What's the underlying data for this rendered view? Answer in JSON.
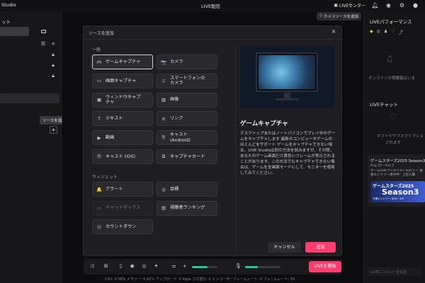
{
  "topbar": {
    "app_name": "Studio",
    "window_title": "LIVE配信",
    "live_center": "LIVEセンター"
  },
  "left_panel": {
    "title": "ット",
    "tooltip": "ソースを追加",
    "plus": "+"
  },
  "center": {
    "source_add_chip": "カメラソースを追加"
  },
  "right_panel": {
    "performance_title": "LIVEパフォーマンス",
    "offline_text": "オンラインの視聴者はいま",
    "chat_title": "LIVEチャット",
    "chat_empty_1": "ギフトやサブスクリプショ",
    "chat_empty_2": "されます",
    "card": {
      "title": "ゲームスターズ2025 Season3",
      "date": "Aug 29 - Sep 6",
      "text": "ゲームLIVEクリエイター向けトー 賞金エントリー受付中！上位入賞",
      "banner_line1": "ゲームスターズ2025",
      "banner_line2": "Season3",
      "banner_line3": "予選エントリー: 8/29 - 9/6"
    },
    "chat_input_placeholder": "LIVEにコメントを追加"
  },
  "modal": {
    "title": "ソースを追加",
    "close_glyph": "×",
    "section_general": "一般",
    "section_widget": "ウィジェット",
    "general_sources": [
      {
        "label": "ゲームキャプチャ",
        "icon": "🎮",
        "icon_name": "gamepad-icon",
        "selected": true
      },
      {
        "label": "カメラ",
        "icon": "📷",
        "icon_name": "camera-icon"
      },
      {
        "label": "画面キャプチャ",
        "icon": "▭",
        "icon_name": "screen-icon"
      },
      {
        "label": "スマートフォンの\nカメラ",
        "icon": "▯",
        "icon_name": "smartphone-icon"
      },
      {
        "label": "ウィンドウキャプ\nチャ",
        "icon": "▣",
        "icon_name": "window-icon"
      },
      {
        "label": "画像",
        "icon": "▨",
        "icon_name": "image-icon"
      },
      {
        "label": "テキスト",
        "icon": "T",
        "icon_name": "text-icon"
      },
      {
        "label": "リンク",
        "icon": "⊘",
        "icon_name": "link-icon"
      },
      {
        "label": "動画",
        "icon": "▶",
        "icon_name": "video-icon"
      },
      {
        "label": "キャスト\n(Android)",
        "icon": "⎘",
        "icon_name": "cast-android-icon"
      },
      {
        "label": "キャスト (iOS)",
        "icon": "⎘",
        "icon_name": "cast-ios-icon"
      },
      {
        "label": "キャプチャカード",
        "icon": "⧉",
        "icon_name": "capture-card-icon"
      }
    ],
    "widget_sources": [
      {
        "label": "アラート",
        "icon": "🔔",
        "icon_name": "alert-icon"
      },
      {
        "label": "目標",
        "icon": "◎",
        "icon_name": "goal-icon"
      },
      {
        "label": "チャットボックス",
        "icon": "▭",
        "icon_name": "chatbox-icon",
        "disabled": true
      },
      {
        "label": "視聴者ランキング",
        "icon": "▤",
        "icon_name": "ranking-icon"
      },
      {
        "label": "カウントダウン",
        "icon": "◷",
        "icon_name": "countdown-icon"
      }
    ],
    "description_title": "ゲームキャプチャ",
    "description_text": "デスクトップまたはノートパソコンでプレイ中のゲームをキャプチャします 最新のコンピュータゲームのほとんどをサポート ゲームをキャプチャできない場合、LIVE Studioは別の方法を試みますが、その際、あなたのゲーム画面だけ黄色いフレームが表示されることがあります。この方法でもキャプチャできない場合は、ゲームを全画面モードにして、モニターを使用してみてください。",
    "cancel_label": "キャンセル",
    "add_label": "追加"
  },
  "toolbar": {
    "live_start_label": "LIVEを開始",
    "mic_level": 0.62,
    "audio_level": 0.35
  },
  "status": {
    "text": "CPU: 0.58%   メモリー: 0.42%   アップロード: 0 kbps   コマ落ち: 0   エンコーダーフレームレート: 0   フレームレート: 30"
  },
  "colors": {
    "accent_pink": "#ff3d6e",
    "slider_green": "#27c5a2"
  }
}
